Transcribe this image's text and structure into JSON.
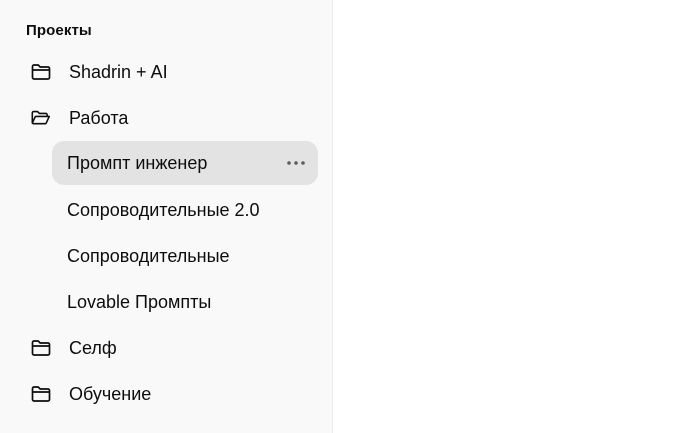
{
  "sidebar": {
    "section_title": "Проекты",
    "projects": [
      {
        "label": "Shadrin + AI",
        "icon": "folder-icon"
      },
      {
        "label": "Работа",
        "icon": "folder-open-icon"
      },
      {
        "label": "Селф",
        "icon": "folder-icon"
      },
      {
        "label": "Обучение",
        "icon": "folder-icon"
      }
    ],
    "work_chats": [
      {
        "label": "Промпт инженер",
        "active": true,
        "menu_icon": "more-horizontal-icon"
      },
      {
        "label": "Сопроводительные 2.0",
        "active": false
      },
      {
        "label": "Сопроводительные",
        "active": false
      },
      {
        "label": "Lovable Промпты",
        "active": false
      }
    ]
  },
  "colors": {
    "sidebar_bg": "#f9f9f9",
    "active_row_bg": "#e3e3e3",
    "text": "#0d0d0d",
    "main_bg": "#ffffff"
  }
}
